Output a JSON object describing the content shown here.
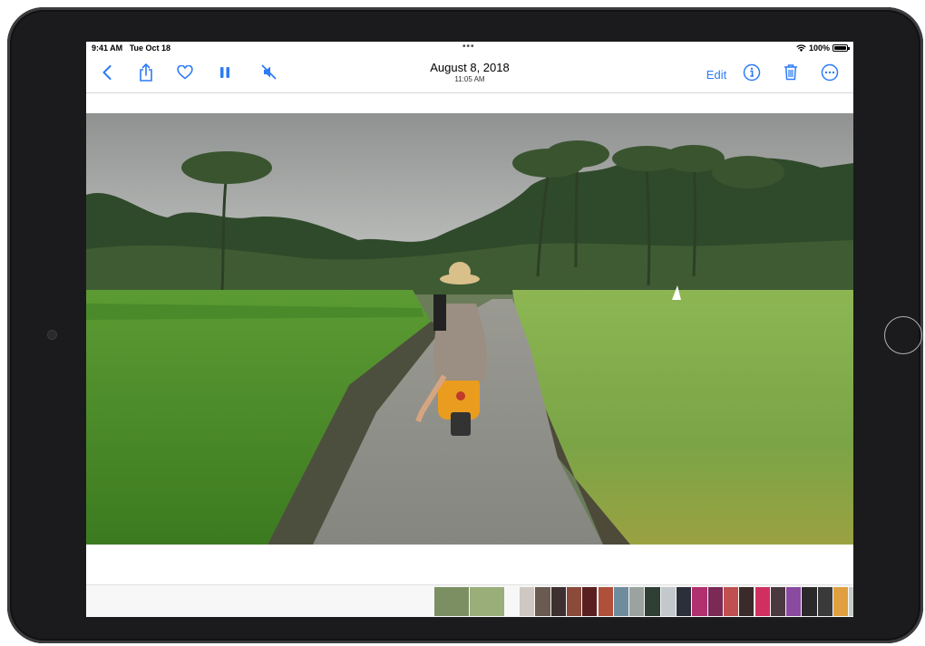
{
  "status_bar": {
    "time": "9:41 AM",
    "date": "Tue Oct 18",
    "battery": "100%",
    "dots": "•••"
  },
  "nav": {
    "date": "August 8, 2018",
    "time": "11:05 AM",
    "edit_label": "Edit",
    "icons": [
      "back-icon",
      "share-icon",
      "heart-icon",
      "pause-icon",
      "mute-icon",
      "info-icon",
      "trash-icon",
      "more-icon"
    ]
  },
  "colors": {
    "accent": "#2d7bf6",
    "frame": "#1b1b1d"
  },
  "filmstrip": {
    "thumbnail_colors": [
      "#7b8f63",
      "#9aae7a",
      "#cfc8c2",
      "#6b5a52",
      "#3e3030",
      "#8b4a3a",
      "#5a2020",
      "#b0503a",
      "#6f8c9c",
      "#9aa3a0",
      "#2f3f35",
      "#c2c8cc",
      "#2c2f3a",
      "#b03070",
      "#7a2a55",
      "#c05050",
      "#3a2a2a",
      "#d03060",
      "#4a3a40",
      "#8a4aa0",
      "#2a2a2a",
      "#3a3a3a",
      "#e0a040",
      "#c8ccc8",
      "#6a6e70",
      "#3a4a5a",
      "#8a8478"
    ]
  }
}
